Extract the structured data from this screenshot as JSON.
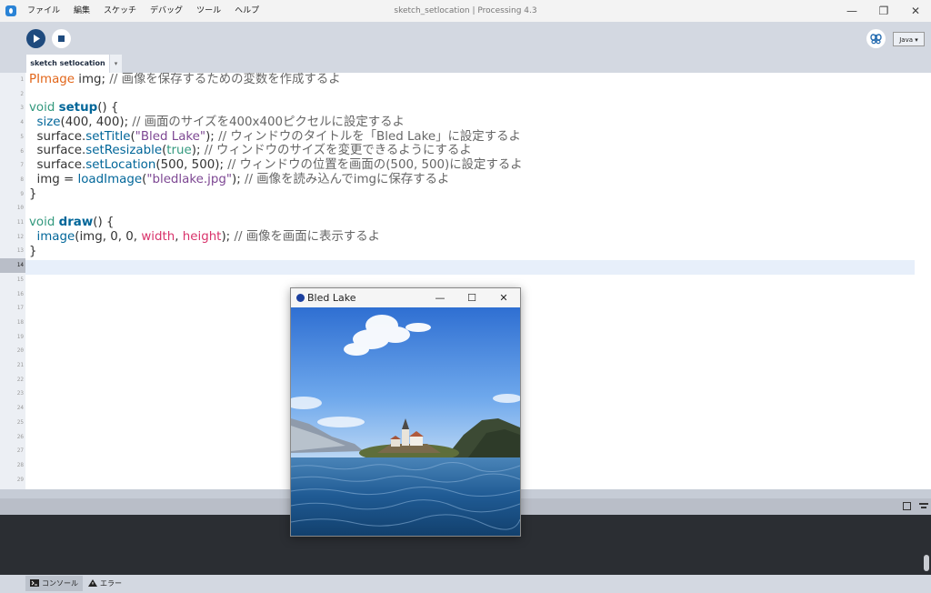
{
  "window": {
    "title": "sketch_setlocation | Processing 4.3",
    "minimize": "—",
    "restore": "❐",
    "close": "✕"
  },
  "menu": [
    "ファイル",
    "編集",
    "スケッチ",
    "デバッグ",
    "ツール",
    "ヘルプ"
  ],
  "toolbar": {
    "mode": "Java ▾"
  },
  "tab": {
    "name": "sketch setlocation",
    "arrow": "▾"
  },
  "line_numbers": [
    "1",
    "2",
    "3",
    "4",
    "5",
    "6",
    "7",
    "8",
    "9",
    "10",
    "11",
    "12",
    "13",
    "14",
    "15",
    "16",
    "17",
    "18",
    "19",
    "20",
    "21",
    "22",
    "23",
    "24",
    "25",
    "26",
    "27",
    "28",
    "29"
  ],
  "current_line": 14,
  "code": {
    "l1": {
      "type": "PImage",
      "rest": " img; ",
      "comment": "// 画像を保存するための変数を作成するよ"
    },
    "l3": {
      "kw": "void",
      "sp": " ",
      "fn": "setup",
      "rest": "() {"
    },
    "l4": {
      "indent": "  ",
      "fn": "size",
      "args": "(400, 400); ",
      "comment": "// 画面のサイズを400x400ピクセルに設定するよ"
    },
    "l5": {
      "indent": "  surface.",
      "fn": "setTitle",
      "p1": "(",
      "str": "\"Bled Lake\"",
      "p2": "); ",
      "comment": "// ウィンドウのタイトルを「Bled Lake」に設定するよ"
    },
    "l6": {
      "indent": "  surface.",
      "fn": "setResizable",
      "p1": "(",
      "kw": "true",
      "p2": "); ",
      "comment": "// ウィンドウのサイズを変更できるようにするよ"
    },
    "l7": {
      "indent": "  surface.",
      "fn": "setLocation",
      "args": "(500, 500); ",
      "comment": "// ウィンドウの位置を画面の(500, 500)に設定するよ"
    },
    "l8": {
      "indent": "  img = ",
      "fn": "loadImage",
      "p1": "(",
      "str": "\"bledlake.jpg\"",
      "p2": "); ",
      "comment": "// 画像を読み込んでimgに保存するよ"
    },
    "l9": {
      "text": "}"
    },
    "l11": {
      "kw": "void",
      "sp": " ",
      "fn": "draw",
      "rest": "() {"
    },
    "l12": {
      "indent": "  ",
      "fn": "image",
      "args": "(img, 0, 0, ",
      "v1": "width",
      "sep": ", ",
      "v2": "height",
      "p2": "); ",
      "comment": "// 画像を画面に表示するよ"
    },
    "l13": {
      "text": "}"
    }
  },
  "footer": {
    "console": "コンソール",
    "errors": "エラー"
  },
  "sketch_window": {
    "title": "Bled Lake",
    "minimize": "—",
    "maximize": "☐",
    "close": "✕"
  },
  "colors": {
    "accent": "#1f4b7e",
    "gutter": "#eceff4",
    "editor_bg": "#ffffff",
    "console_bg": "#2b2e33",
    "type": "#e2661a",
    "keyword": "#33997e",
    "function": "#006699",
    "string": "#7d4793",
    "variable": "#d9336b"
  }
}
